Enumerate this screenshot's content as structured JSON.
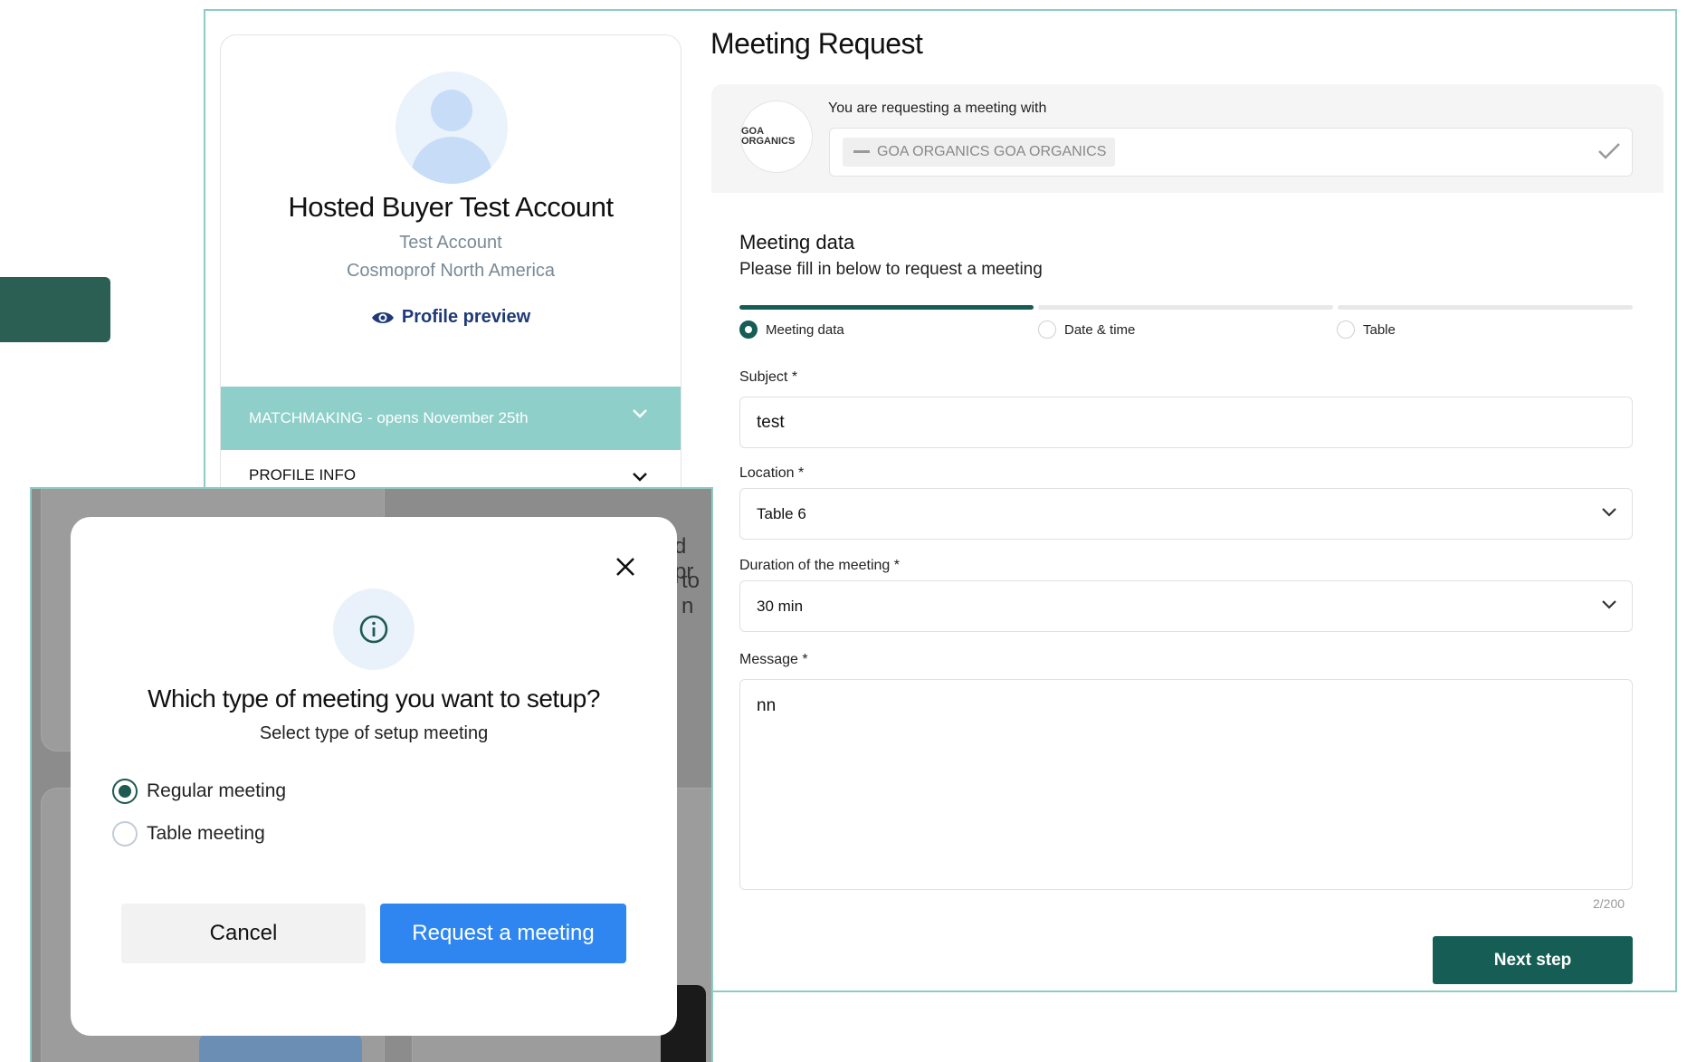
{
  "profile": {
    "name": "Hosted Buyer Test Account",
    "role": "Test Account",
    "event": "Cosmoprof North America",
    "preview_label": "Profile preview",
    "sections": {
      "matchmaking": "MATCHMAKING - opens November 25th",
      "profile_info": "PROFILE INFO"
    }
  },
  "meeting_request": {
    "title": "Meeting Request",
    "requesting_label": "You are requesting a meeting with",
    "company_logo_text": "GOA ORGANICS",
    "company_chip": "GOA ORGANICS GOA ORGANICS",
    "section_title": "Meeting data",
    "section_subtitle": "Please fill in below to request a meeting",
    "steps": [
      {
        "label": "Meeting data",
        "active": true
      },
      {
        "label": "Date & time",
        "active": false
      },
      {
        "label": "Table",
        "active": false
      }
    ],
    "progress": 0.333,
    "fields": {
      "subject": {
        "label": "Subject *",
        "value": "test"
      },
      "location": {
        "label": "Location *",
        "value": "Table 6"
      },
      "duration": {
        "label": "Duration of the meeting *",
        "value": "30 min"
      },
      "message": {
        "label": "Message *",
        "value": "nn",
        "char_count": "2/200"
      }
    },
    "next_label": "Next step"
  },
  "background_text": {
    "line1": "d pr",
    "line2": "to n"
  },
  "modal": {
    "title": "Which type of meeting you want to setup?",
    "subtitle": "Select type of setup meeting",
    "options": [
      {
        "label": "Regular meeting",
        "selected": true
      },
      {
        "label": "Table meeting",
        "selected": false
      }
    ],
    "cancel_label": "Cancel",
    "request_label": "Request a meeting"
  },
  "colors": {
    "primary_green": "#165e55",
    "teal_bar": "#8ecfc9",
    "blue_button": "#2f86f0",
    "profile_link": "#1f3a78"
  },
  "icons": [
    "eye-icon",
    "chevron-down-icon",
    "check-icon",
    "close-icon",
    "info-icon"
  ]
}
